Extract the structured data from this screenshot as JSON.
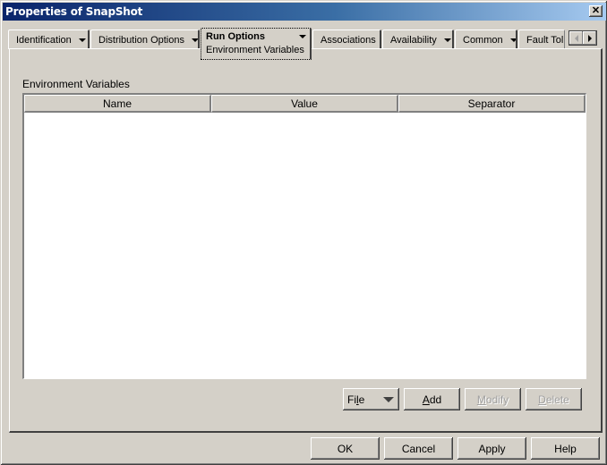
{
  "window": {
    "title": "Properties of SnapShot",
    "close_glyph": "✕"
  },
  "tabs": [
    {
      "label": "Identification",
      "has_dropdown": true
    },
    {
      "label": "Distribution Options",
      "has_dropdown": true
    },
    {
      "label": "Run Options",
      "has_dropdown": true,
      "active": true,
      "subpage": "Environment Variables"
    },
    {
      "label": "Associations",
      "has_dropdown": false
    },
    {
      "label": "Availability",
      "has_dropdown": true
    },
    {
      "label": "Common",
      "has_dropdown": true
    },
    {
      "label": "Fault Tolerance",
      "visible_text": "Fault Tol",
      "has_dropdown": false
    }
  ],
  "tab_scroll": {
    "left_enabled": false,
    "right_enabled": true
  },
  "section": {
    "label": "Environment Variables"
  },
  "table": {
    "columns": [
      "Name",
      "Value",
      "Separator"
    ],
    "rows": []
  },
  "actions": {
    "file": {
      "label": "File",
      "mnemonic_prefix": "Fi",
      "mnemonic": "l",
      "mnemonic_suffix": "e"
    },
    "add": {
      "label": "Add",
      "mnemonic": "A",
      "rest": "dd",
      "enabled": true
    },
    "modify": {
      "label": "Modify",
      "mnemonic": "M",
      "rest": "odify",
      "enabled": false
    },
    "delete": {
      "label": "Delete",
      "mnemonic": "D",
      "rest": "elete",
      "enabled": false
    }
  },
  "footer": {
    "ok": "OK",
    "cancel": "Cancel",
    "apply": "Apply",
    "help": "Help"
  }
}
